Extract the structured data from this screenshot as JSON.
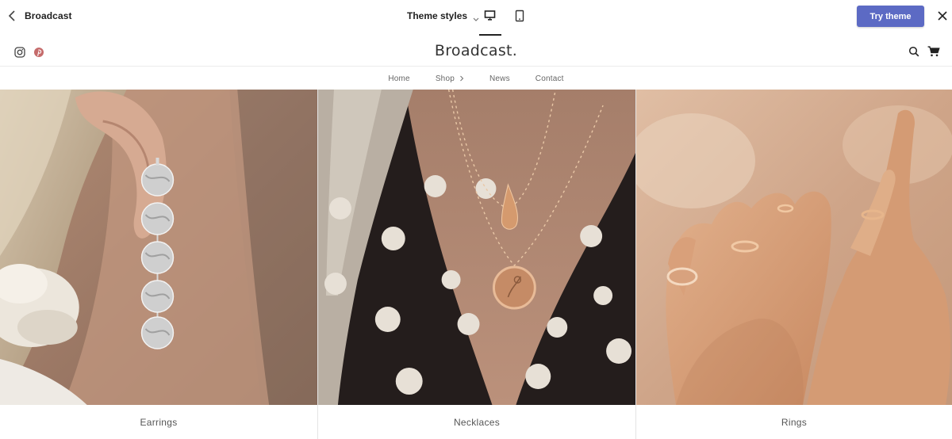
{
  "toolbar": {
    "back_icon": "chevron-left-icon",
    "theme_name": "Broadcast",
    "theme_styles_label": "Theme styles",
    "view_desktop_icon": "desktop-icon",
    "view_mobile_icon": "mobile-icon",
    "try_theme_label": "Try theme",
    "close_icon": "close-icon",
    "accent_color": "#5c6ac4"
  },
  "store": {
    "brand": "Broadcast.",
    "social": [
      "instagram-icon",
      "pinterest-icon"
    ],
    "search_icon": "search-icon",
    "cart_icon": "cart-icon"
  },
  "nav": {
    "items": [
      {
        "label": "Home"
      },
      {
        "label": "Shop",
        "has_submenu": true
      },
      {
        "label": "News"
      },
      {
        "label": "Contact"
      }
    ]
  },
  "collections": [
    {
      "label": "Earrings"
    },
    {
      "label": "Necklaces"
    },
    {
      "label": "Rings"
    }
  ]
}
